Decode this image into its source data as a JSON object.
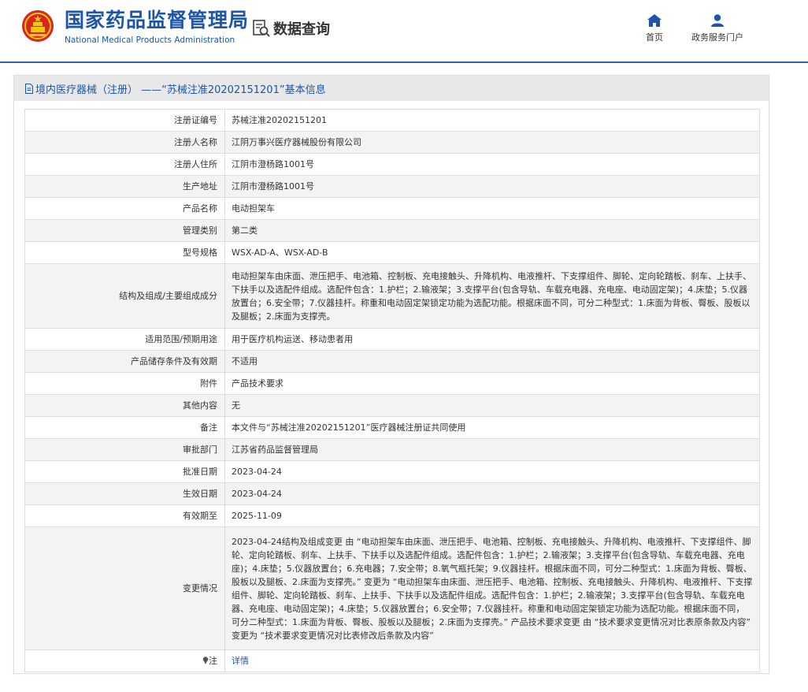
{
  "header": {
    "brand_cn": "国家药品监督管理局",
    "brand_en": "National Medical Products Administration",
    "data_query": "数据查询",
    "nav": [
      {
        "label": "首页",
        "icon": "home-icon"
      },
      {
        "label": "政务服务门户",
        "icon": "user-icon"
      }
    ]
  },
  "panel": {
    "title": "境内医疗器械（注册） ——“苏械注准20202151201”基本信息"
  },
  "rows": [
    {
      "label": "注册证编号",
      "value": "苏械注准20202151201"
    },
    {
      "label": "注册人名称",
      "value": "江阴万事兴医疗器械股份有限公司"
    },
    {
      "label": "注册人住所",
      "value": "江阴市澄杨路1001号"
    },
    {
      "label": "生产地址",
      "value": "江阴市澄杨路1001号"
    },
    {
      "label": "产品名称",
      "value": "电动担架车"
    },
    {
      "label": "管理类别",
      "value": "第二类"
    },
    {
      "label": "型号规格",
      "value": "WSX-AD-A、WSX-AD-B"
    },
    {
      "label": "结构及组成/主要组成成分",
      "value": "电动担架车由床面、泄压把手、电池箱、控制板、充电接触头、升降机构、电液推杆、下支撑组件、脚轮、定向轮踏板、刹车、上扶手、下扶手以及选配件组成。选配件包含：1.护栏；2.输液架；3.支撑平台(包含导轨、车载充电器、充电座、电动固定架)；4.床垫；5.仪器放置台；6.安全带；7.仪器挂杆。称重和电动固定架锁定功能为选配功能。根据床面不同，可分二种型式：1.床面为背板、臀板、股板以及腿板；2.床面为支撑壳。"
    },
    {
      "label": "适用范围/预期用途",
      "value": "用于医疗机构运送、移动患者用"
    },
    {
      "label": "产品储存条件及有效期",
      "value": "不适用"
    },
    {
      "label": "附件",
      "value": "产品技术要求"
    },
    {
      "label": "其他内容",
      "value": "无"
    },
    {
      "label": "备注",
      "value": "本文件与“苏械注准20202151201”医疗器械注册证共同使用"
    },
    {
      "label": "审批部门",
      "value": "江苏省药品监督管理局"
    },
    {
      "label": "批准日期",
      "value": "2023-04-24"
    },
    {
      "label": "生效日期",
      "value": "2023-04-24"
    },
    {
      "label": "有效期至",
      "value": "2025-11-09"
    },
    {
      "label": "变更情况",
      "value": "2023-04-24结构及组成变更 由 “电动担架车由床面、泄压把手、电池箱、控制板、充电接触头、升降机构、电液推杆、下支撑组件、脚轮、定向轮踏板、刹车、上扶手、下扶手以及选配件组成。选配件包含：1.护栏；2.输液架；3.支撑平台(包含导轨、车载充电器、充电座)；4.床垫；5.仪器放置台；6.充电器；7.安全带；8.氧气瓶托架；9.仪器挂杆。根据床面不同，可分二种型式：1.床面为背板、臀板、股板以及腿板、2.床面为支撑壳。” 变更为 “电动担架车由床面、泄压把手、电池箱、控制板、充电接触头、升降机构、电液推杆、下支撑组件、脚轮、定向轮踏板、刹车、上扶手、下扶手以及选配件组成。选配件包含：1.护栏；2.输液架；3.支撑平台(包含导轨、车载充电器、充电座、电动固定架)；4.床垫；5.仪器放置台；6.安全带；7.仪器挂杆。称重和电动固定架锁定功能为选配功能。根据床面不同，可分二种型式：1.床面为背板、臀板、股板以及腿板；2.床面为支撑壳。” 产品技术要求变更 由 “技术要求变更情况对比表原条款及内容” 变更为 “技术要求变更情况对比表修改后条款及内容”"
    }
  ],
  "note_row": {
    "label": "注",
    "value": "详情"
  }
}
